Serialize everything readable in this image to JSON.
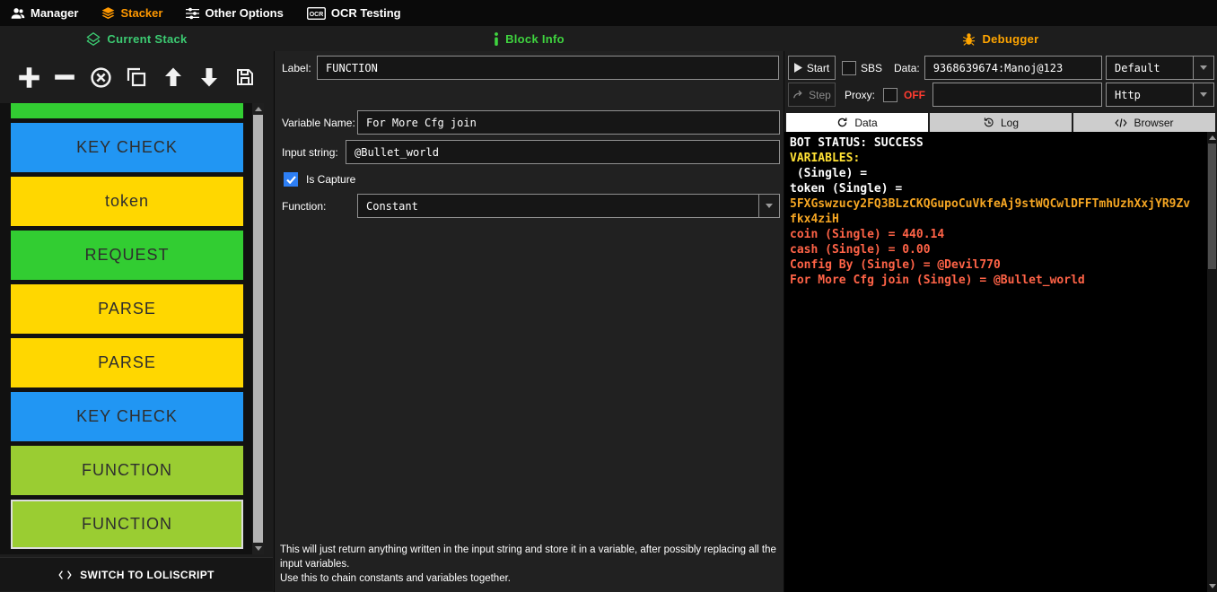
{
  "menubar": {
    "items": [
      {
        "label": "Manager",
        "icon": "users-icon"
      },
      {
        "label": "Stacker",
        "icon": "stack-icon",
        "color": "#FF9800"
      },
      {
        "label": "Other Options",
        "icon": "sliders-icon"
      },
      {
        "label": "OCR Testing",
        "icon": "ocr-icon"
      }
    ],
    "ocr_icon_text": "OCR"
  },
  "headers": {
    "current_stack": {
      "label": "Current Stack",
      "color": "#3CCB72",
      "icon": "layers-diamond-icon"
    },
    "block_info": {
      "label": "Block Info",
      "color": "#3FD43F",
      "icon": "info-icon"
    },
    "debugger": {
      "label": "Debugger",
      "color": "#FFA500",
      "icon": "bug-icon"
    }
  },
  "stack": {
    "toolbar": [
      {
        "name": "add",
        "icon": "plus-icon"
      },
      {
        "name": "remove",
        "icon": "minus-icon"
      },
      {
        "name": "disable",
        "icon": "circle-x-icon"
      },
      {
        "name": "clone",
        "icon": "clone-icon"
      },
      {
        "name": "move-up",
        "icon": "arrow-up-icon"
      },
      {
        "name": "move-down",
        "icon": "arrow-down-icon"
      },
      {
        "name": "save",
        "icon": "save-icon"
      }
    ],
    "blocks": [
      {
        "label": "",
        "color": "#32CD32",
        "partial": true
      },
      {
        "label": "KEY CHECK",
        "color": "#2196F3"
      },
      {
        "label": "token",
        "color": "#FFD700"
      },
      {
        "label": "REQUEST",
        "color": "#32CD32"
      },
      {
        "label": "PARSE",
        "color": "#FFD700"
      },
      {
        "label": "PARSE",
        "color": "#FFD700"
      },
      {
        "label": "KEY CHECK",
        "color": "#2196F3"
      },
      {
        "label": "FUNCTION",
        "color": "#9ACD32"
      },
      {
        "label": "FUNCTION",
        "color": "#9ACD32",
        "selected": true
      }
    ],
    "switch_button_label": "SWITCH TO LOLISCRIPT"
  },
  "block_info": {
    "label_field": {
      "label": "Label:",
      "value": "FUNCTION"
    },
    "variable_name_field": {
      "label": "Variable Name:",
      "value": "For More Cfg join"
    },
    "input_string_field": {
      "label": "Input string:",
      "value": "@Bullet_world"
    },
    "is_capture": {
      "label": "Is Capture",
      "checked": true
    },
    "function_field": {
      "label": "Function:",
      "value": "Constant"
    },
    "description": "This will just return anything written in the input string and store it in a variable, after possibly replacing all the input variables.\nUse this to chain constants and variables together."
  },
  "debugger": {
    "start_button": "Start",
    "step_button": "Step",
    "sbs_checkbox": {
      "label": "SBS",
      "checked": false
    },
    "data_field": {
      "label": "Data:",
      "value": "9368639674:Manoj@123"
    },
    "wordlist_type": "Default",
    "proxy": {
      "label": "Proxy:",
      "checked": false,
      "status": "OFF",
      "status_color": "#FF3B30",
      "value": "",
      "type": "Http"
    },
    "tabs": [
      {
        "label": "Data",
        "icon": "refresh-icon",
        "active": true
      },
      {
        "label": "Log",
        "icon": "history-icon",
        "active": false
      },
      {
        "label": "Browser",
        "icon": "code-icon",
        "active": false
      }
    ],
    "output": [
      {
        "segments": [
          {
            "text": "BOT STATUS: SUCCESS",
            "color": "#FFFFFF"
          }
        ]
      },
      {
        "segments": [
          {
            "text": "VARIABLES:",
            "color": "#FFE135"
          }
        ]
      },
      {
        "segments": [
          {
            "text": " (Single) = ",
            "color": "#FFFFFF"
          }
        ]
      },
      {
        "segments": [
          {
            "text": "token (Single) = ",
            "color": "#FFFFFF"
          },
          {
            "text": "5FXGswzucy2FQ3BLzCKQGupoCuVkfeAj9stWQCwlDFFTmhUzhXxjYR9Zvfkx4ziH",
            "color": "#F5A623"
          }
        ]
      },
      {
        "segments": [
          {
            "text": "coin (Single) = 440.14",
            "color": "#FF6347"
          }
        ]
      },
      {
        "segments": [
          {
            "text": "cash (Single) = 0.00",
            "color": "#FF6347"
          }
        ]
      },
      {
        "segments": [
          {
            "text": "Config By (Single) = @Devil770",
            "color": "#FF6347"
          }
        ]
      },
      {
        "segments": [
          {
            "text": "For More Cfg join (Single) = @Bullet_world",
            "color": "#FF6347"
          }
        ]
      }
    ]
  }
}
